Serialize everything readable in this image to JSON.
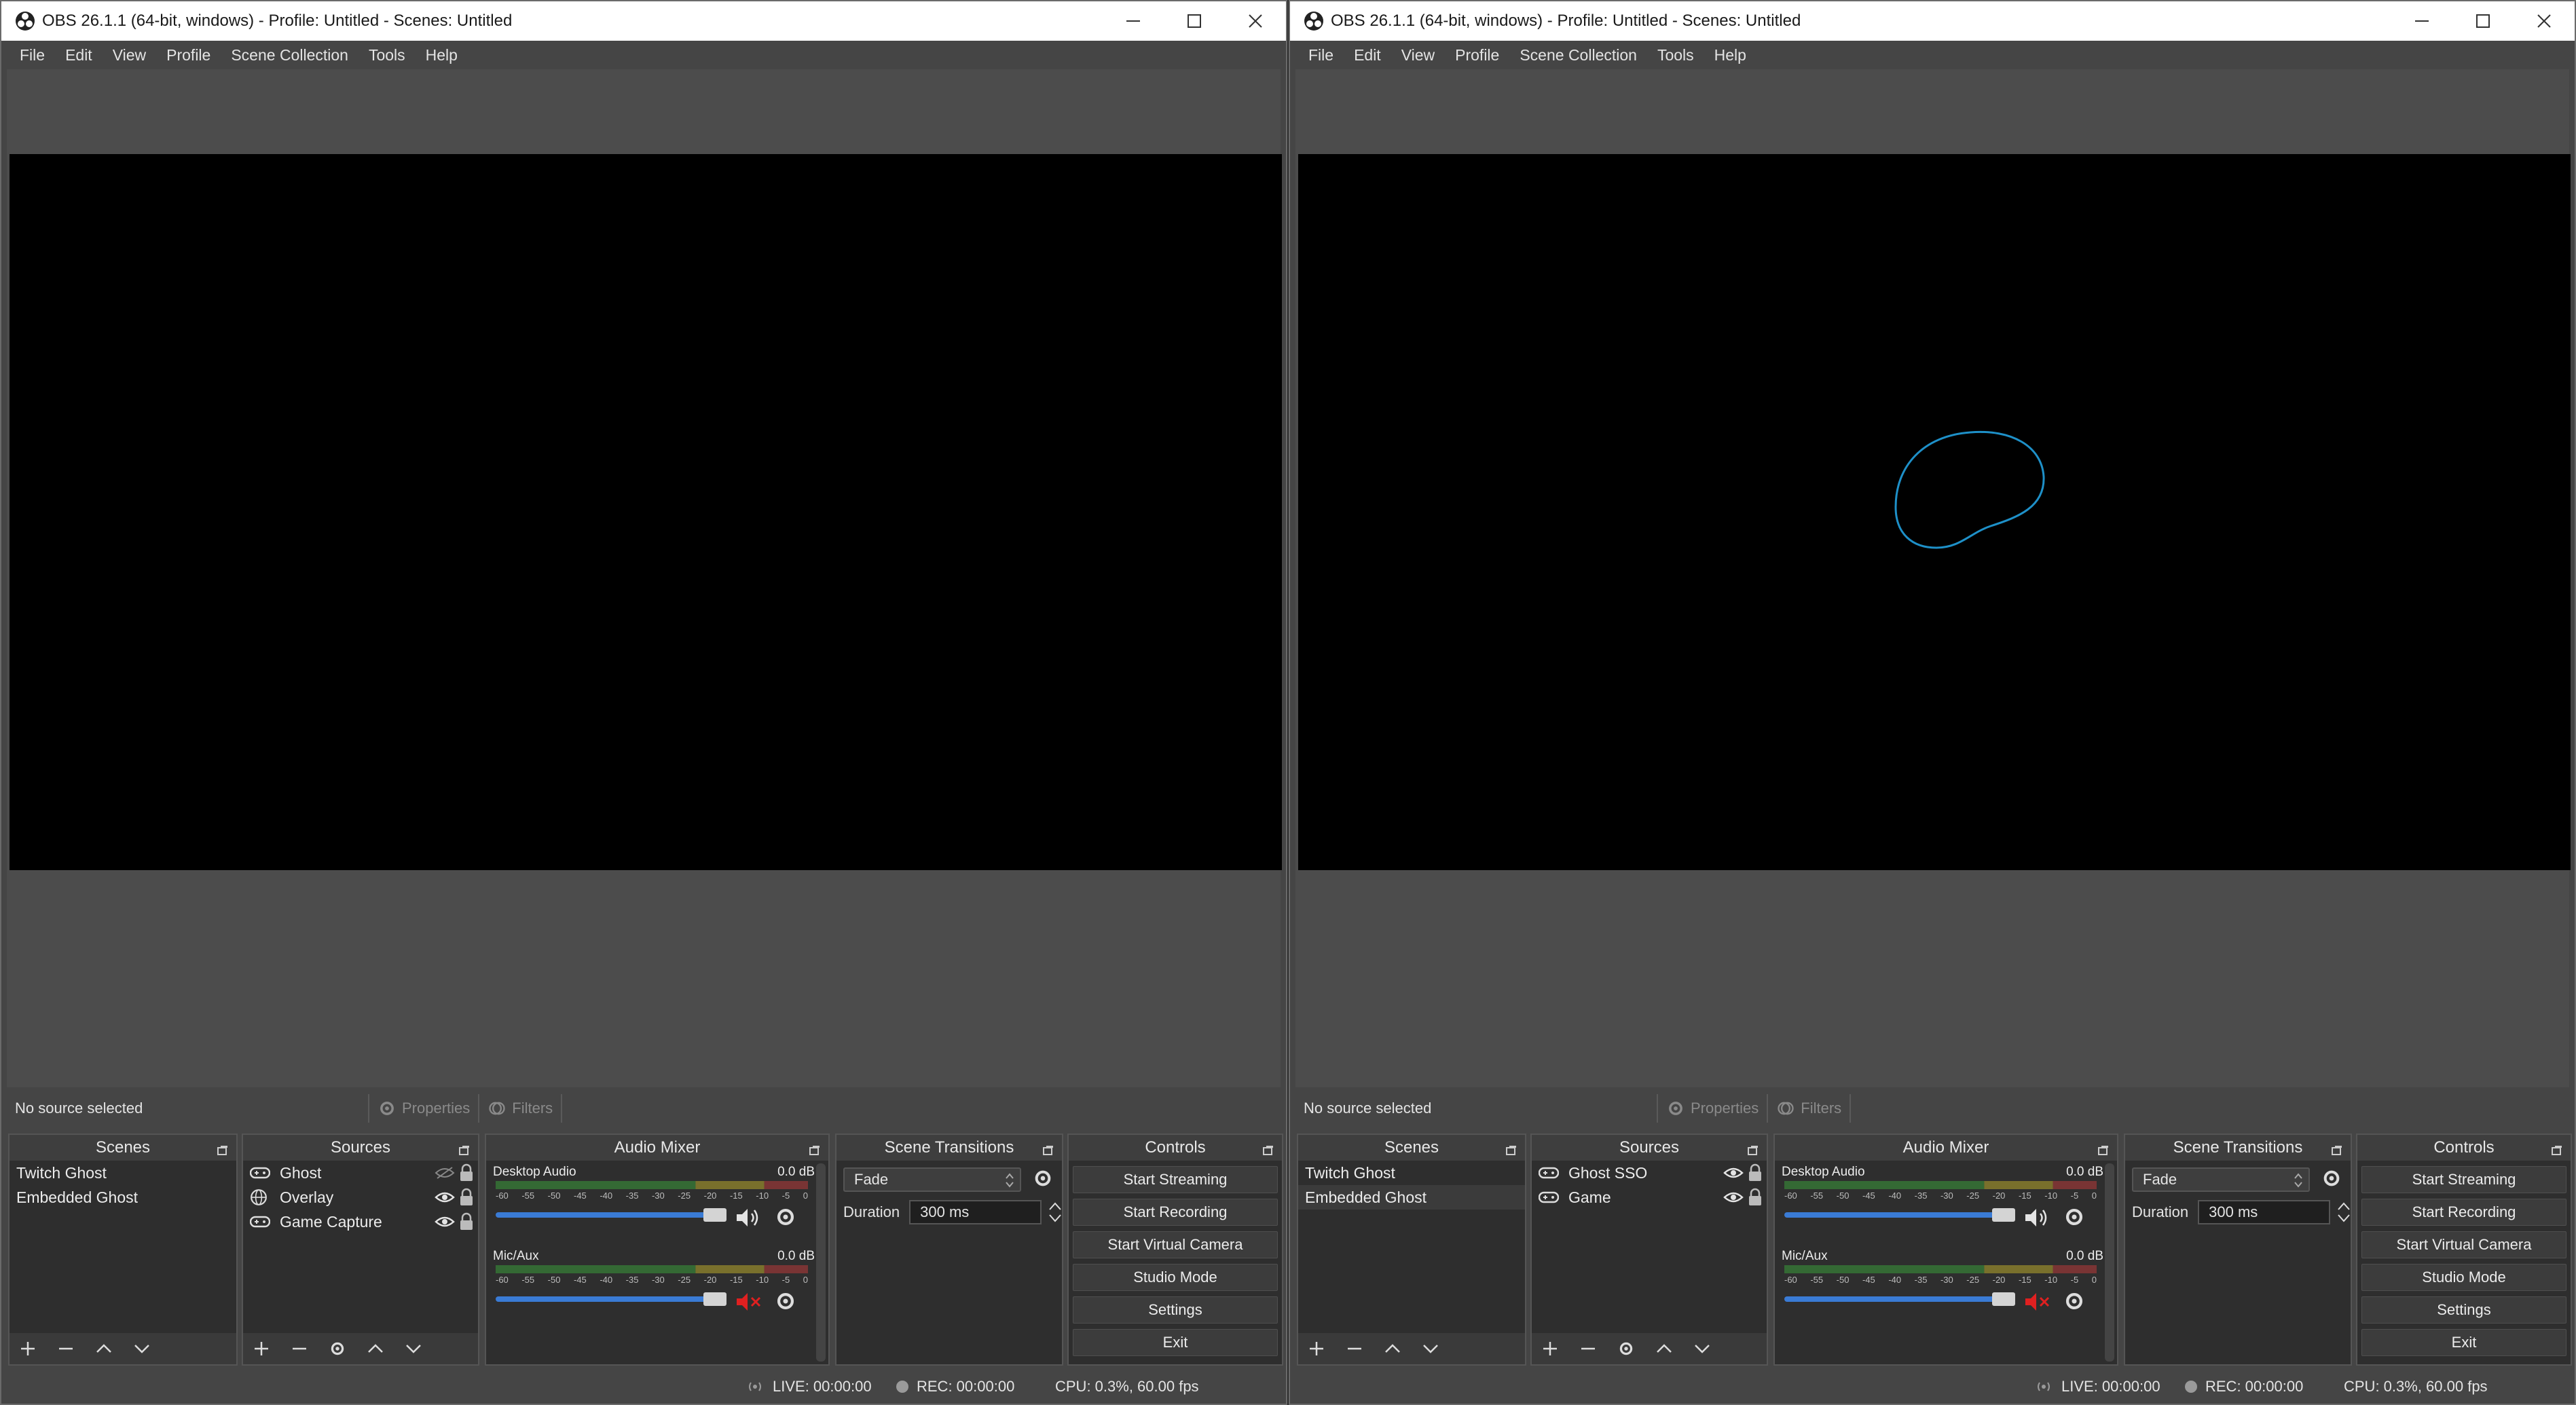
{
  "windows": [
    {
      "title": "OBS 26.1.1 (64-bit, windows) - Profile: Untitled - Scenes: Untitled",
      "menu": [
        "File",
        "Edit",
        "View",
        "Profile",
        "Scene Collection",
        "Tools",
        "Help"
      ],
      "no_source": "No source selected",
      "properties_label": "Properties",
      "filters_label": "Filters",
      "docks": {
        "scenes_title": "Scenes",
        "sources_title": "Sources",
        "mixer_title": "Audio Mixer",
        "transitions_title": "Scene Transitions",
        "controls_title": "Controls"
      },
      "scenes": [
        "Twitch Ghost",
        "Embedded Ghost"
      ],
      "selected_scene": "",
      "sources": [
        {
          "name": "Ghost",
          "type_icon": "gamepad-icon",
          "visible": false,
          "locked": true
        },
        {
          "name": "Overlay",
          "type_icon": "globe-icon",
          "visible": true,
          "locked": true
        },
        {
          "name": "Game Capture",
          "type_icon": "gamepad-icon",
          "visible": true,
          "locked": true
        }
      ],
      "mixer": [
        {
          "name": "Desktop Audio",
          "db": "0.0 dB",
          "muted": false
        },
        {
          "name": "Mic/Aux",
          "db": "0.0 dB",
          "muted": true
        }
      ],
      "meter_scale": [
        "-60",
        "-55",
        "-50",
        "-45",
        "-40",
        "-35",
        "-30",
        "-25",
        "-20",
        "-15",
        "-10",
        "-5",
        "0"
      ],
      "transition": "Fade",
      "duration_label": "Duration",
      "duration_value": "300 ms",
      "controls": [
        "Start Streaming",
        "Start Recording",
        "Start Virtual Camera",
        "Studio Mode",
        "Settings",
        "Exit"
      ],
      "status": {
        "live": "LIVE: 00:00:00",
        "rec": "REC: 00:00:00",
        "cpu": "CPU: 0.3%, 60.00 fps"
      },
      "preview_has_ghost": false
    },
    {
      "title": "OBS 26.1.1 (64-bit, windows) - Profile: Untitled - Scenes: Untitled",
      "menu": [
        "File",
        "Edit",
        "View",
        "Profile",
        "Scene Collection",
        "Tools",
        "Help"
      ],
      "no_source": "No source selected",
      "properties_label": "Properties",
      "filters_label": "Filters",
      "docks": {
        "scenes_title": "Scenes",
        "sources_title": "Sources",
        "mixer_title": "Audio Mixer",
        "transitions_title": "Scene Transitions",
        "controls_title": "Controls"
      },
      "scenes": [
        "Twitch Ghost",
        "Embedded Ghost"
      ],
      "selected_scene": "Embedded Ghost",
      "sources": [
        {
          "name": "Ghost SSO",
          "type_icon": "gamepad-icon",
          "visible": true,
          "locked": true
        },
        {
          "name": "Game",
          "type_icon": "gamepad-icon",
          "visible": true,
          "locked": true
        }
      ],
      "mixer": [
        {
          "name": "Desktop Audio",
          "db": "0.0 dB",
          "muted": false
        },
        {
          "name": "Mic/Aux",
          "db": "0.0 dB",
          "muted": true
        }
      ],
      "meter_scale": [
        "-60",
        "-55",
        "-50",
        "-45",
        "-40",
        "-35",
        "-30",
        "-25",
        "-20",
        "-15",
        "-10",
        "-5",
        "0"
      ],
      "transition": "Fade",
      "duration_label": "Duration",
      "duration_value": "300 ms",
      "controls": [
        "Start Streaming",
        "Start Recording",
        "Start Virtual Camera",
        "Studio Mode",
        "Settings",
        "Exit"
      ],
      "status": {
        "live": "LIVE: 00:00:00",
        "rec": "REC: 00:00:00",
        "cpu": "CPU: 0.3%, 60.00 fps"
      },
      "preview_has_ghost": true
    }
  ],
  "colors": {
    "accent_fader": "#3a7bd5",
    "muted_red": "#e02020",
    "ghost_outline": "#1e90c8",
    "meter_green": "#3a9a3a",
    "meter_yellow": "#b8a72c",
    "meter_red": "#b83a3a"
  }
}
